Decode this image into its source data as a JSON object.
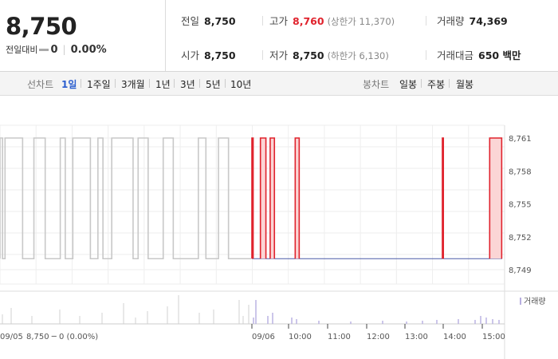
{
  "summary": {
    "price": "8,750",
    "change_label": "전일대비",
    "change_value": "0",
    "change_pct": "0.00%"
  },
  "stats": {
    "prev_close_label": "전일",
    "prev_close": "8,750",
    "high_label": "고가",
    "high": "8,760",
    "upper_limit_text": "(상한가 11,370)",
    "volume_label": "거래량",
    "volume": "74,369",
    "open_label": "시가",
    "open": "8,750",
    "low_label": "저가",
    "low": "8,750",
    "lower_limit_text": "(하한가 6,130)",
    "amount_label": "거래대금",
    "amount": "650 백만"
  },
  "line_tabs": {
    "label": "선차트",
    "items": [
      "1일",
      "1주일",
      "3개월",
      "1년",
      "3년",
      "5년",
      "10년"
    ],
    "selected": "1일"
  },
  "candle_tabs": {
    "label": "봉차트",
    "items": [
      "일봉",
      "주봉",
      "월봉"
    ]
  },
  "colors": {
    "up": "#e0232d",
    "base": "#4a5aa8",
    "prev": "#c8c8c8",
    "volume": "#b7aee0"
  },
  "chart_data": {
    "type": "line",
    "y_ticks": [
      "8,761",
      "8,758",
      "8,755",
      "8,752",
      "8,749"
    ],
    "ylim": [
      8749,
      8761
    ],
    "baseline": 8750,
    "legend": "거래량",
    "prev_day_label": "09/05",
    "prev_day_info": "8,750 ─ 0 (0.00%)",
    "x_ticks": [
      "09/06",
      "10:00",
      "11:00",
      "12:00",
      "13:00",
      "14:00",
      "15:00"
    ],
    "prev_day_spikes": [
      [
        0.0,
        0.01
      ],
      [
        0.02,
        0.09
      ],
      [
        0.135,
        0.18
      ],
      [
        0.24,
        0.26
      ],
      [
        0.29,
        0.36
      ],
      [
        0.39,
        0.41
      ],
      [
        0.445,
        0.53
      ],
      [
        0.55,
        0.59
      ],
      [
        0.65,
        0.69
      ],
      [
        0.79,
        0.82
      ],
      [
        0.87,
        0.91
      ]
    ],
    "today_spikes": [
      [
        0.0,
        0.005
      ],
      [
        0.034,
        0.056
      ],
      [
        0.073,
        0.09
      ],
      [
        0.173,
        0.189
      ],
      [
        0.761,
        0.765
      ],
      [
        0.95,
        0.998
      ]
    ]
  }
}
